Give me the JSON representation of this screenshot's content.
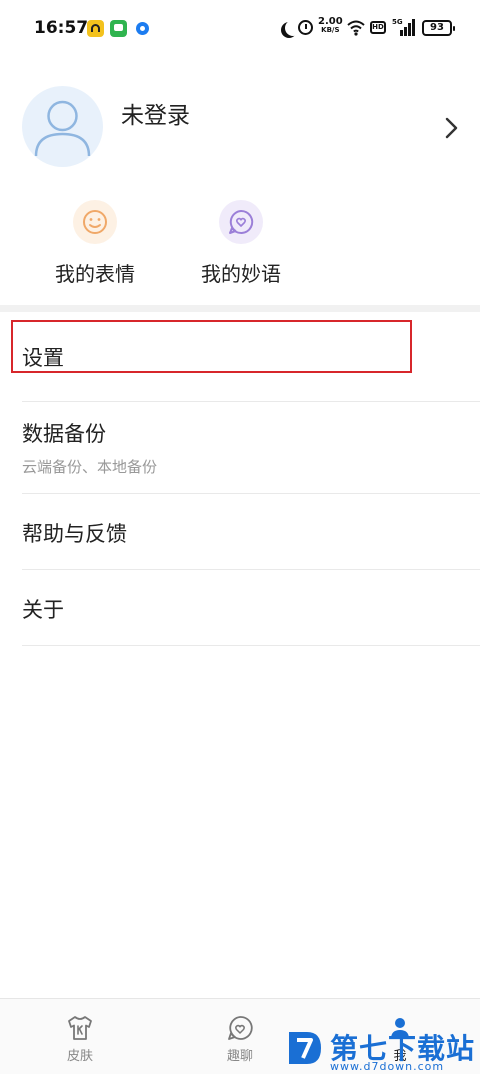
{
  "status_bar": {
    "time": "16:57",
    "net_speed": "2.00",
    "net_unit": "KB/S",
    "hd": "HD",
    "signal": "5G",
    "battery": "93",
    "icons": [
      "app-a-icon",
      "message-app-icon",
      "dot-app-icon",
      "moon-icon",
      "alarm-icon",
      "wifi-icon",
      "hd-icon",
      "signal-icon",
      "battery-icon"
    ]
  },
  "profile": {
    "name": "未登录",
    "avatar_icon": "user-avatar-icon",
    "chevron_icon": "chevron-right-icon"
  },
  "quick_actions": [
    {
      "label": "我的表情",
      "icon": "smiley-icon",
      "color": "#f4b37a"
    },
    {
      "label": "我的妙语",
      "icon": "heart-bubble-icon",
      "color": "#9b7fd8"
    }
  ],
  "menu": [
    {
      "title": "设置",
      "subtitle": ""
    },
    {
      "title": "数据备份",
      "subtitle": "云端备份、本地备份"
    },
    {
      "title": "帮助与反馈",
      "subtitle": ""
    },
    {
      "title": "关于",
      "subtitle": ""
    }
  ],
  "highlight_color": "#d7262b",
  "bottom_nav": [
    {
      "label": "皮肤",
      "icon": "tshirt-icon"
    },
    {
      "label": "趣聊",
      "icon": "chat-heart-icon"
    },
    {
      "label": "我",
      "icon": "profile-icon"
    }
  ],
  "watermark": {
    "text": "第七下载站",
    "url": "www.d7down.com",
    "color": "#1a6fd4"
  }
}
